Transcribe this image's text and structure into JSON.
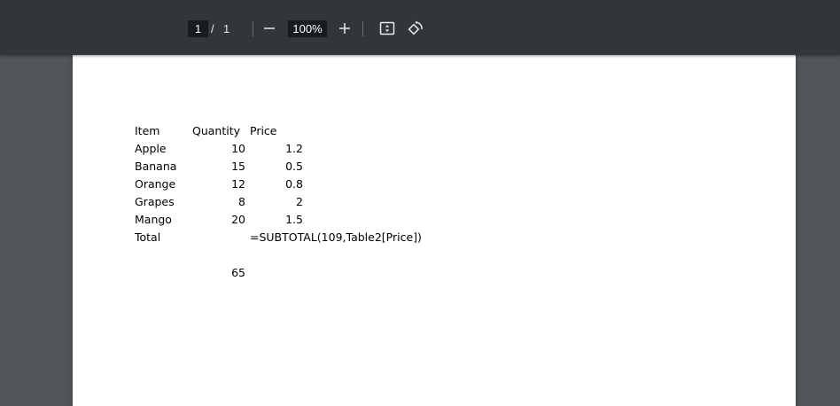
{
  "toolbar": {
    "page_current": "1",
    "page_separator": "/",
    "page_total": "1",
    "zoom": "100%",
    "icons": [
      "minus-icon",
      "plus-icon",
      "fit-page-icon",
      "rotate-icon"
    ]
  },
  "sheet": {
    "headers": {
      "item": "Item",
      "quantity": "Quantity",
      "price": "Price"
    },
    "rows": [
      {
        "item": "Apple",
        "quantity": "10",
        "price": "1.2"
      },
      {
        "item": "Banana",
        "quantity": "15",
        "price": "0.5"
      },
      {
        "item": "Orange",
        "quantity": "12",
        "price": "0.8"
      },
      {
        "item": "Grapes",
        "quantity": "8",
        "price": "2"
      },
      {
        "item": "Mango",
        "quantity": "20",
        "price": "1.5"
      }
    ],
    "total_label": "Total",
    "total_formula": "=SUBTOTAL(109,Table2[Price])",
    "total_quantity": "65"
  },
  "colors": {
    "toolbar_bg": "#323639",
    "viewer_bg": "#525659",
    "page_bg": "#ffffff",
    "input_bg": "#191b1c"
  }
}
